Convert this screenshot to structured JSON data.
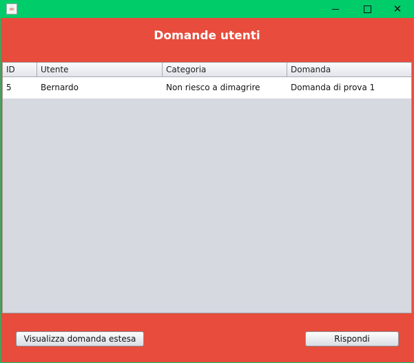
{
  "window": {
    "app_icon": "java-icon"
  },
  "heading": "Domande utenti",
  "table": {
    "columns": [
      "ID",
      "Utente",
      "Categoria",
      "Domanda"
    ],
    "rows": [
      [
        "5",
        "Bernardo",
        "Non riesco a dimagrire",
        "Domanda di prova 1"
      ]
    ]
  },
  "buttons": {
    "view_label": "Visualizza domanda estesa",
    "reply_label": "Rispondi"
  },
  "colors": {
    "titlebar": "#00cc6a",
    "background": "#e74c3c",
    "table_background": "#d6d9e0"
  }
}
